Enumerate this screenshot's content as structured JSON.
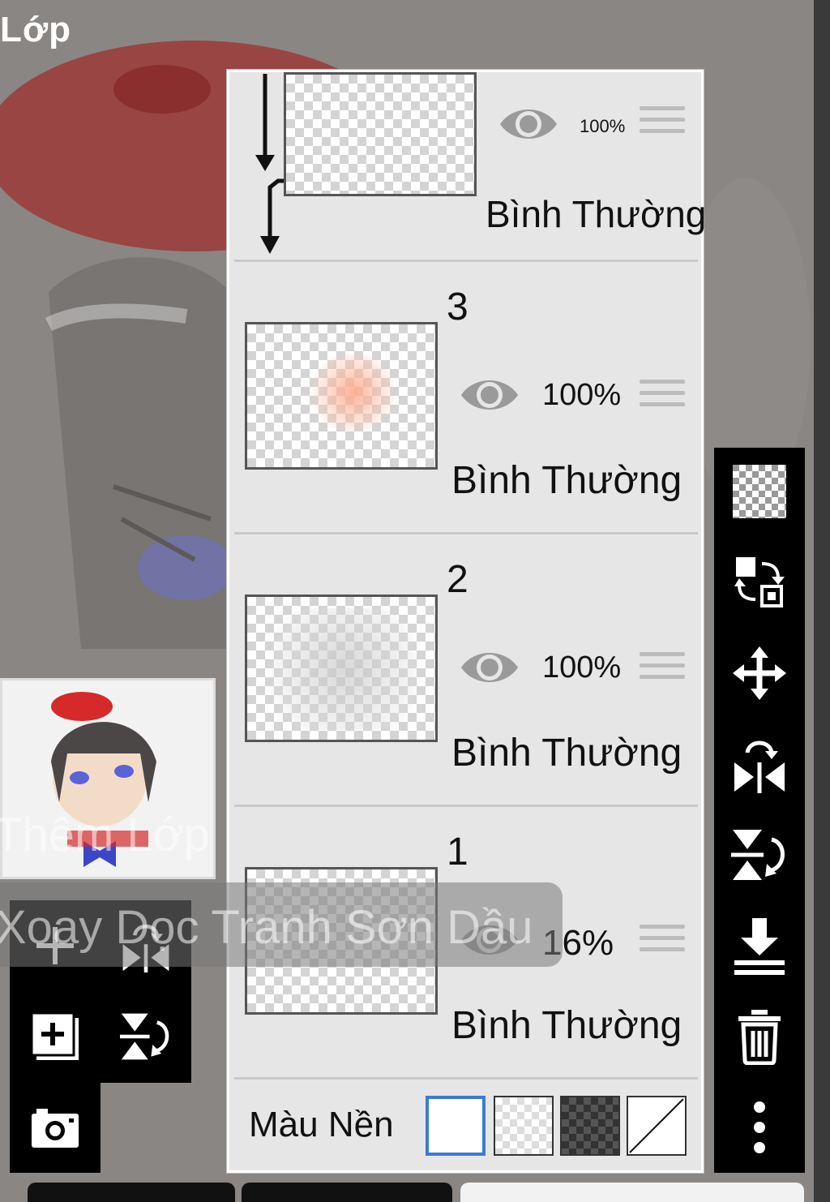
{
  "screen": {
    "title": "Lớp"
  },
  "layers": [
    {
      "number": "",
      "opacity": "100%",
      "blend": "Bình Thường",
      "visible": true
    },
    {
      "number": "3",
      "opacity": "100%",
      "blend": "Bình Thường",
      "visible": true
    },
    {
      "number": "2",
      "opacity": "100%",
      "blend": "Bình Thường",
      "visible": true
    },
    {
      "number": "1",
      "opacity": "16%",
      "blend": "Bình Thường",
      "visible": true
    }
  ],
  "background": {
    "label": "Màu Nền",
    "options": [
      "white",
      "transparent",
      "dark-checker",
      "none"
    ],
    "selected": "white"
  },
  "right_toolbar": {
    "items": [
      "transparency-icon",
      "swap-layers-icon",
      "move-icon",
      "flip-horizontal-icon",
      "flip-vertical-icon",
      "merge-down-icon",
      "trash-icon",
      "more-vertical-icon"
    ]
  },
  "left_toolbar": {
    "items": [
      "add-layer-icon",
      "flip-horizontal-icon",
      "add-image-layer-icon",
      "flip-vertical-icon",
      "camera-icon"
    ]
  },
  "ghost_labels": {
    "add_layer": "Thêm Lớp",
    "toast": "Xoay Dọc Tranh Sơn Dầu"
  },
  "colors": {
    "accent": "#3a7bd5",
    "panel": "#e6e6e6",
    "toolbar": "#000000"
  }
}
